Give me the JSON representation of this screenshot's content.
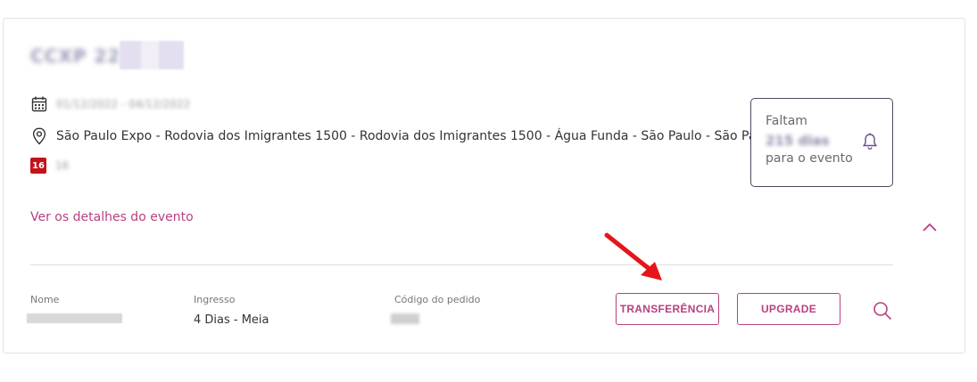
{
  "event": {
    "title_blurred": "CCXP 22",
    "date_blurred": "01/12/2022 - 04/12/2022",
    "location": "São Paulo Expo - Rodovia dos Imigrantes 1500 - Rodovia dos Imigrantes 1500 - Água Funda - São Paulo - São Paulo",
    "age_badge": "16",
    "age_text_blurred": "16",
    "details_link": "Ver os detalhes do evento"
  },
  "countdown": {
    "prefix": "Faltam",
    "days_blurred": "215 dias",
    "suffix": "para o evento"
  },
  "order": {
    "name_label": "Nome",
    "ticket_label": "Ingresso",
    "ticket_value": "4 Dias - Meia",
    "code_label": "Código do pedido"
  },
  "actions": {
    "transfer_label": "TRANSFERÊNCIA",
    "upgrade_label": "UPGRADE"
  },
  "colors": {
    "accent": "#b8417f",
    "age_badge": "#c4121a",
    "annotation_arrow": "#e8141b"
  }
}
